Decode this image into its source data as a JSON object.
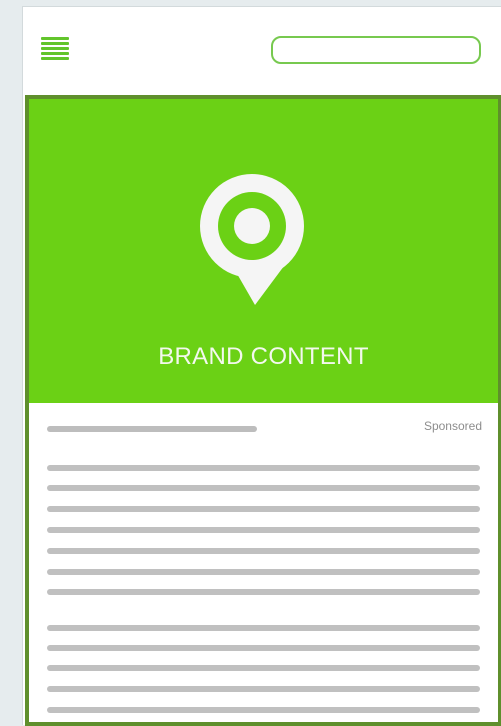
{
  "header": {
    "menu_icon": "hamburger-menu-icon",
    "search": {
      "value": "",
      "placeholder": ""
    }
  },
  "ad": {
    "brand_icon": "location-speech-bubble-icon",
    "title": "BRAND CONTENT",
    "sponsored_label": "Sponsored"
  },
  "colors": {
    "background": "#e6ecee",
    "accent_green": "#6bd115",
    "card_border": "#5f8f2c",
    "search_border": "#77c94f",
    "placeholder_line": "#c0c0c0"
  }
}
